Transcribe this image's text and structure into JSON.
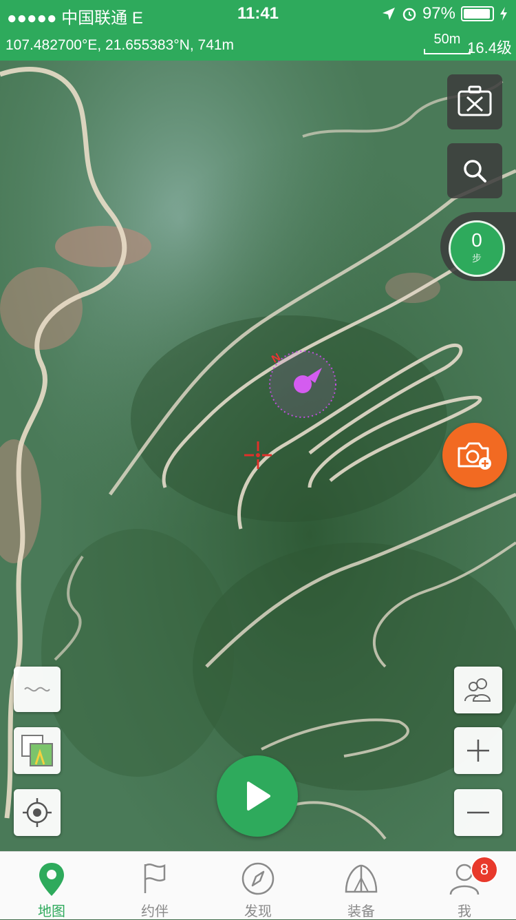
{
  "status_bar": {
    "carrier": "●●●●● 中国联通  E",
    "time": "11:41",
    "battery_text": "97%",
    "battery_level": 0.97
  },
  "coord_bar": {
    "coordinates": "107.482700°E, 21.655383°N, 741m",
    "scale_label": "50m",
    "zoom_level": "16.4级"
  },
  "map": {
    "compass_north": "N"
  },
  "right_controls": {
    "step_count": "0",
    "step_unit": "步"
  },
  "tabbar": {
    "tabs": [
      {
        "label": "地图",
        "icon": "map-pin-icon",
        "active": true
      },
      {
        "label": "约伴",
        "icon": "flag-icon"
      },
      {
        "label": "发现",
        "icon": "compass-icon"
      },
      {
        "label": "装备",
        "icon": "tent-icon"
      },
      {
        "label": "我",
        "icon": "user-icon",
        "badge": "8"
      }
    ]
  },
  "colors": {
    "accent": "#2eaa5c",
    "camera": "#f26a22",
    "badge": "#e8392b",
    "location": "#d45cf0"
  }
}
